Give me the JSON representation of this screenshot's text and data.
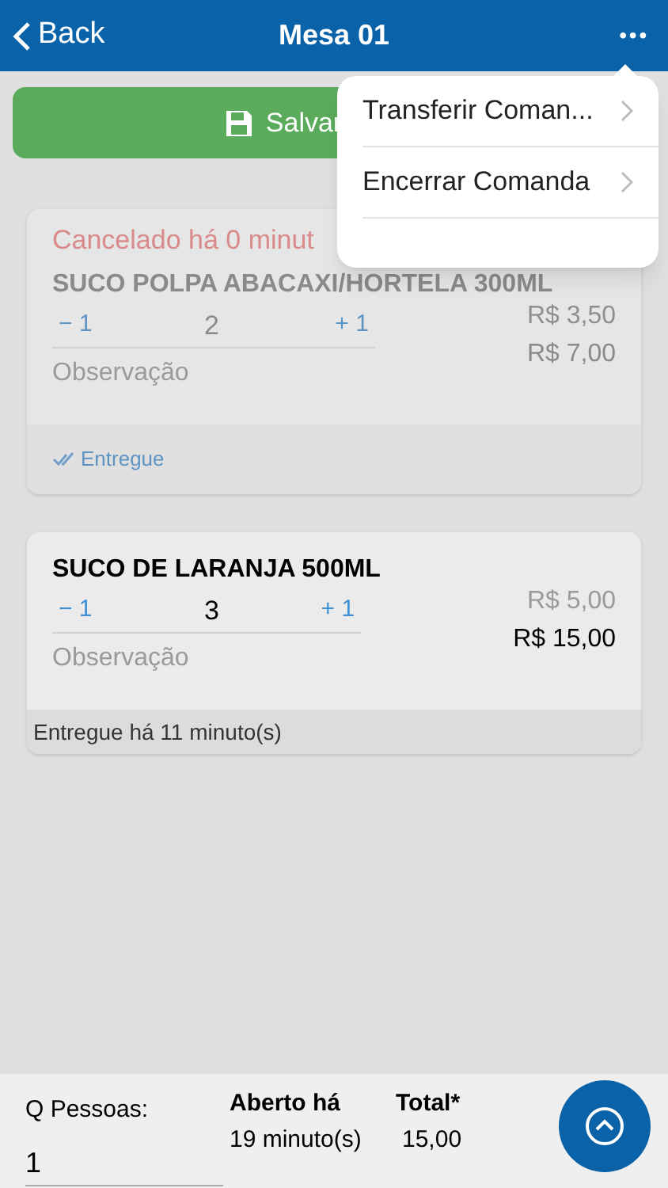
{
  "header": {
    "back": "Back",
    "title": "Mesa 01",
    "more": "•••"
  },
  "save_button": {
    "label": "Salvar"
  },
  "menu": {
    "items": [
      {
        "label": "Transferir Coman..."
      },
      {
        "label": "Encerrar Comanda"
      }
    ]
  },
  "items": [
    {
      "kind": "canceled",
      "status_title": "Cancelado há 0 minut",
      "name": "SUCO POLPA ABACAXI/HORTELA 300ML",
      "minus": "− 1",
      "qty": "2",
      "plus": "+ 1",
      "unit_price": "R$ 3,50",
      "total": "R$ 7,00",
      "placeholder": "Observação",
      "footer": "Entregue",
      "footer_check": true
    },
    {
      "kind": "active",
      "name": "SUCO DE LARANJA 500ML",
      "minus": "− 1",
      "qty": "3",
      "plus": "+ 1",
      "unit_price": "R$ 5,00",
      "total": "R$ 15,00",
      "placeholder": "Observação",
      "footer": "Entregue há 11 minuto(s)",
      "footer_check": false
    }
  ],
  "footer": {
    "people_label": "Q Pessoas:",
    "people_value": "1",
    "open_label": "Aberto há",
    "open_value": "19 minuto(s)",
    "total_label": "Total*",
    "total_value": "15,00"
  }
}
